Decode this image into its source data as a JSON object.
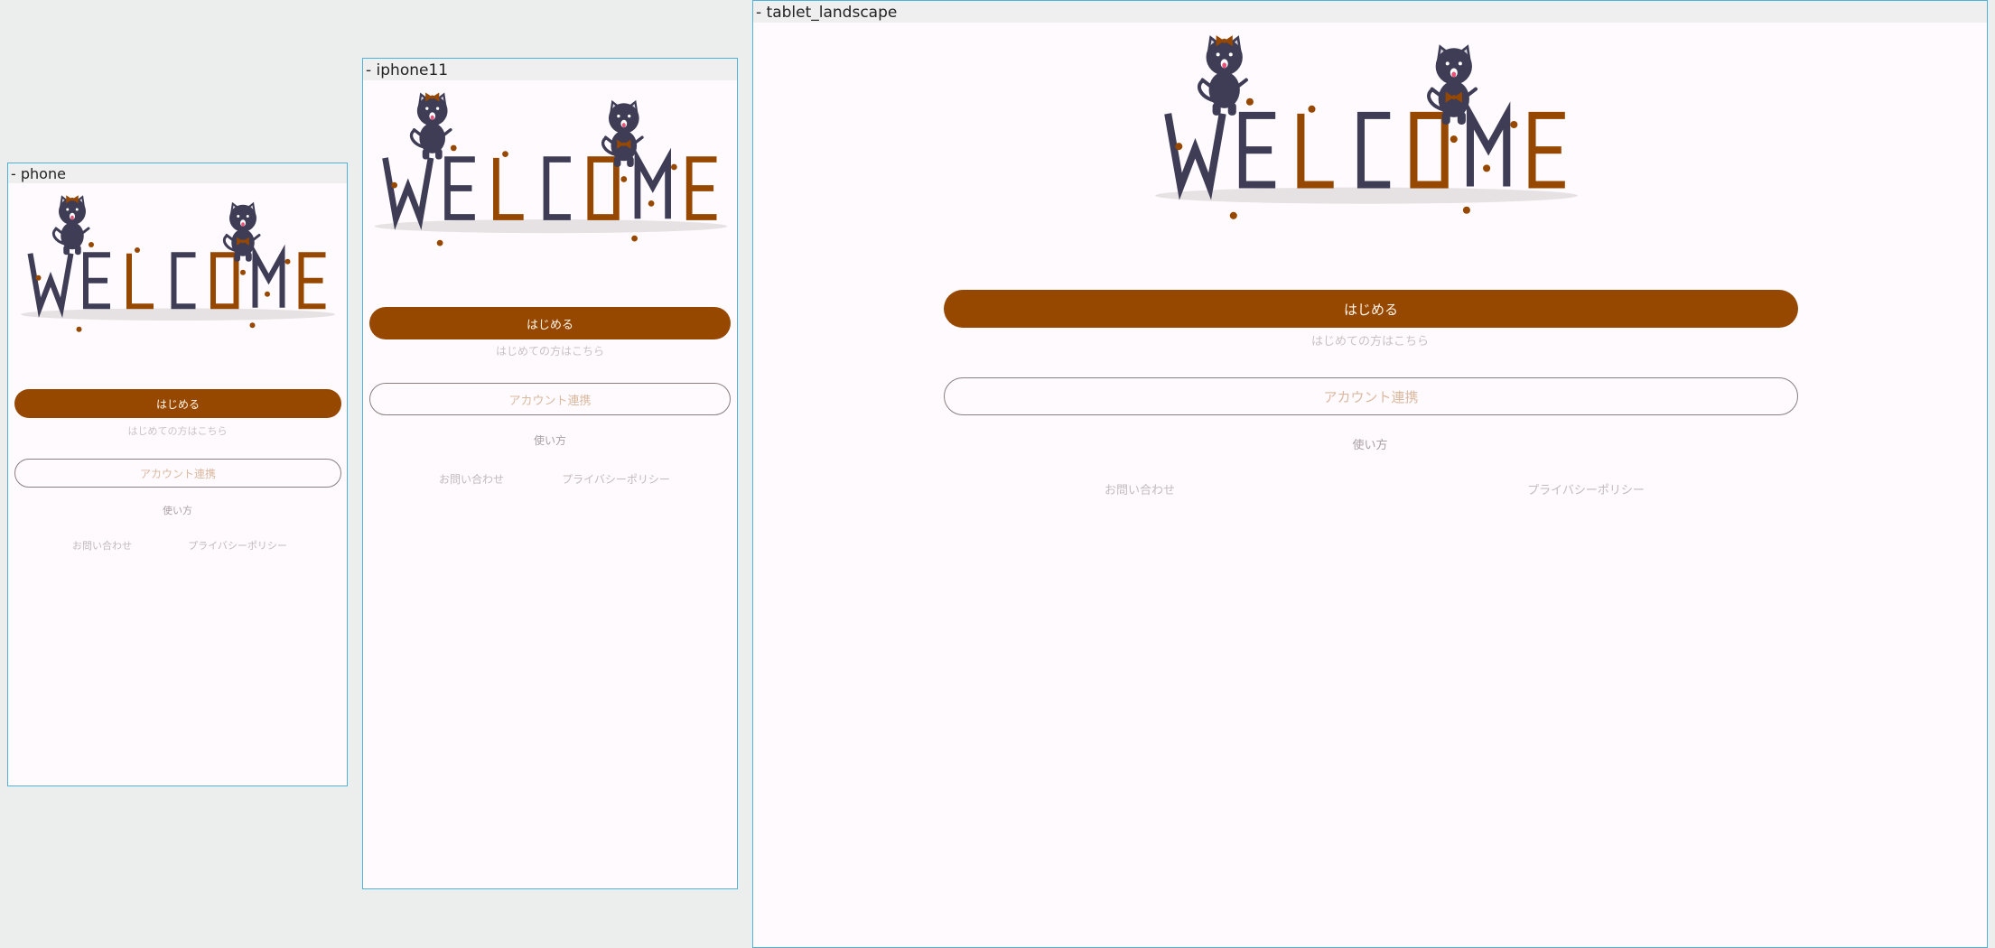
{
  "frames": {
    "phone": {
      "title": "- phone"
    },
    "iphone11": {
      "title": "- iphone11"
    },
    "tablet": {
      "title": "- tablet_landscape"
    }
  },
  "hero": {
    "word": "WELCOME",
    "icon": "welcome-cats-illustration"
  },
  "start": {
    "button_label": "はじめる",
    "caption": "はじめての方はこちら"
  },
  "account": {
    "button_label": "アカウント連携"
  },
  "links": {
    "how_to": "使い方",
    "contact": "お問い合わせ",
    "privacy": "プライバシーポリシー"
  },
  "colors": {
    "accent": "#974800",
    "cat": "#3f3d56",
    "background": "#fffafd",
    "canvas": "#eceeed",
    "frame_border": "#4fb3d9"
  }
}
